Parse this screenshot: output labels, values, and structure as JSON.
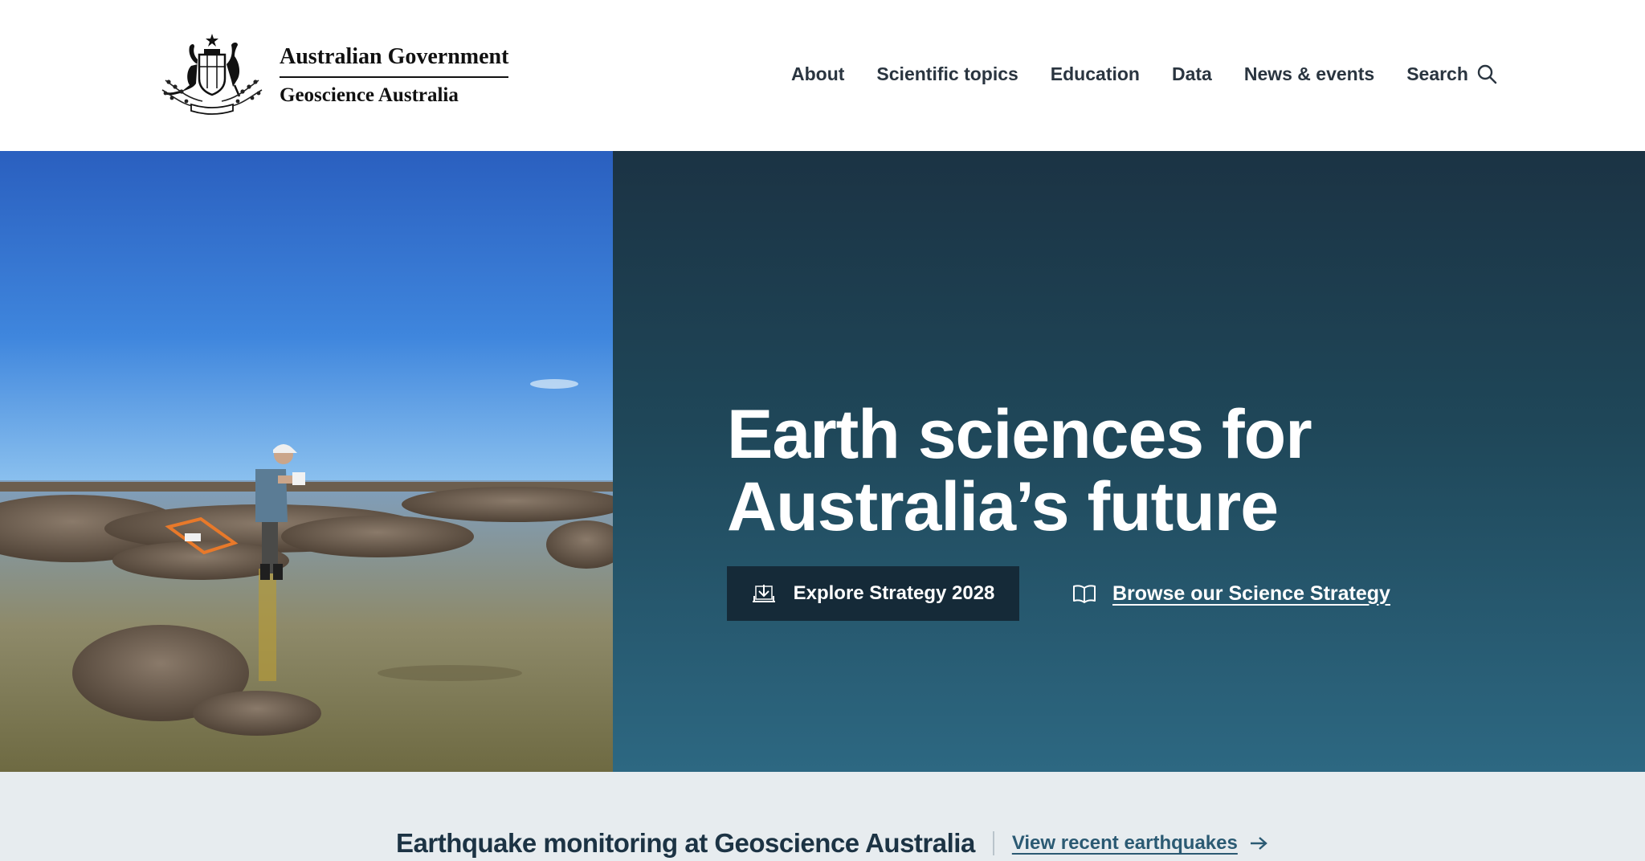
{
  "header": {
    "logo": {
      "line1": "Australian Government",
      "line2": "Geoscience Australia",
      "crest_icon": "commonwealth-coat-of-arms"
    },
    "nav": {
      "items": [
        {
          "label": "About"
        },
        {
          "label": "Scientific topics"
        },
        {
          "label": "Education"
        },
        {
          "label": "Data"
        },
        {
          "label": "News & events"
        }
      ],
      "search_label": "Search",
      "search_icon": "search-icon"
    }
  },
  "hero": {
    "photo_alt": "Scientist standing in shallow water of a coastal wetland taking notes",
    "title_line1": "Earth sciences for",
    "title_line2": "Australia’s future",
    "primary_button": {
      "label": "Explore Strategy 2028",
      "icon": "download-icon"
    },
    "secondary_link": {
      "label": "Browse our Science Strategy",
      "icon": "open-book-icon"
    },
    "colors": {
      "panel_top": "#1b3344",
      "panel_bottom": "#2d6882",
      "button_bg": "#152a38"
    }
  },
  "band": {
    "title": "Earthquake monitoring at Geoscience Australia",
    "link_label": "View recent earthquakes",
    "link_icon": "arrow-right-icon",
    "colors": {
      "background": "#e7ecef",
      "link": "#2b5a73"
    }
  }
}
